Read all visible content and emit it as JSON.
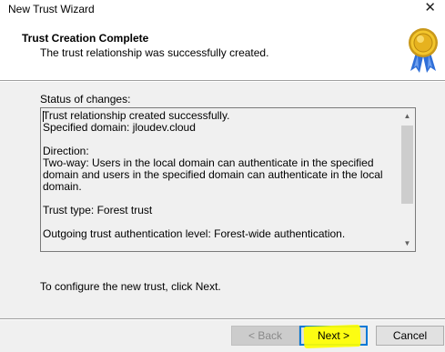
{
  "window": {
    "title": "New Trust Wizard",
    "close_glyph": "✕"
  },
  "header": {
    "title": "Trust Creation Complete",
    "subtitle": "The trust relationship was successfully created.",
    "badge_icon": "award-ribbon-icon",
    "badge_color": "#e8b820"
  },
  "status": {
    "label": "Status of changes:",
    "text": "Trust relationship created successfully.\nSpecified domain: jloudev.cloud\n\nDirection:\nTwo-way: Users in the local domain can authenticate in the specified domain and users in the specified domain can authenticate in the local domain.\n\nTrust type: Forest trust\n\nOutgoing trust authentication level: Forest-wide authentication.\n\nTransitive: Yes"
  },
  "instructions": {
    "configure": "To configure the new trust, click Next."
  },
  "buttons": {
    "back": "< Back",
    "next": "Next >",
    "cancel": "Cancel"
  },
  "highlight_color": "#ffff00",
  "accent_color": "#0078d7"
}
